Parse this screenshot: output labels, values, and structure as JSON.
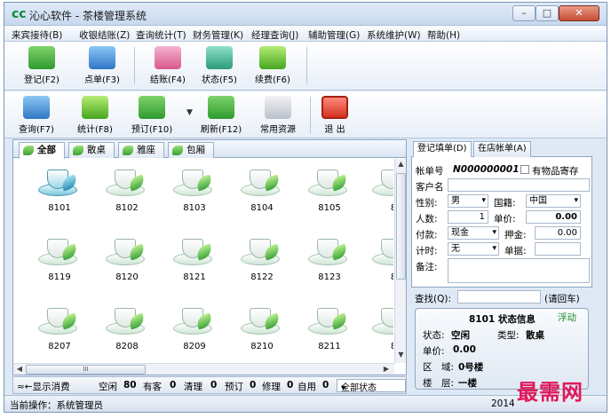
{
  "window": {
    "title": "沁心软件 - 茶楼管理系统",
    "app_icon": "cc",
    "controls": {
      "min": "–",
      "max": "□",
      "close": "✕"
    }
  },
  "menu": [
    "来宾接待(B)",
    "收银结账(Z)",
    "查询统计(T)",
    "财务管理(K)",
    "经理查询(J)",
    "辅助管理(G)",
    "系统维护(W)",
    "帮助(H)"
  ],
  "toolbar1": [
    {
      "label": "登记(F2)",
      "icon": "register-icon",
      "color": "green"
    },
    {
      "label": "点单(F3)",
      "icon": "order-icon",
      "color": "blue"
    },
    {
      "label": "结账(F4)",
      "icon": "checkout-icon",
      "color": "pink"
    },
    {
      "label": "状态(F5)",
      "icon": "status-icon",
      "color": "teal"
    },
    {
      "label": "续费(F6)",
      "icon": "renew-icon",
      "color": "lime"
    }
  ],
  "toolbar2": [
    {
      "label": "查询(F7)",
      "icon": "search-icon",
      "color": "blue"
    },
    {
      "label": "统计(F8)",
      "icon": "stats-icon",
      "color": "lime"
    },
    {
      "label": "预订(F10)",
      "icon": "reserve-icon",
      "color": "green"
    },
    {
      "label": "刷新(F12)",
      "icon": "refresh-icon",
      "color": "green"
    },
    {
      "label": "常用资源",
      "icon": "resources-icon",
      "color": "gray"
    },
    {
      "label": "退  出",
      "icon": "exit-icon",
      "color": "red"
    }
  ],
  "tabs": [
    "全部",
    "散桌",
    "雅座",
    "包厢"
  ],
  "tables": [
    "8101",
    "8102",
    "8103",
    "8104",
    "8105",
    "8",
    "8119",
    "8120",
    "8121",
    "8122",
    "8123",
    "8",
    "8207",
    "8208",
    "8209",
    "8210",
    "8211",
    "8"
  ],
  "scroll": {
    "thumb_mark": "III",
    "up": "▲",
    "down": "▼",
    "left": "◀",
    "right": "▶"
  },
  "stats": {
    "toggle": "≈←显示消费",
    "free_label": "空闲",
    "free": "80",
    "occupied_label": "有客",
    "occupied": "0",
    "cleaning_label": "清理",
    "cleaning": "0",
    "reserved_label": "预订",
    "reserved": "0",
    "repair_label": "修理",
    "repair": "0",
    "selfuse_label": "自用",
    "selfuse": "0",
    "filter": "全部状态"
  },
  "right_tabs": [
    "登记填单(D)",
    "在店帐单(A)"
  ],
  "form": {
    "bill_no_label": "帐单号",
    "bill_no": "N000000001",
    "deposit_label": "有物品寄存",
    "customer_label": "客户名",
    "customer": "",
    "gender_label": "性别:",
    "gender": "男",
    "nationality_label": "国籍:",
    "nationality": "中国",
    "people_label": "人数:",
    "people": "1",
    "price_label": "单价:",
    "price": "0.00",
    "pay_label": "付款:",
    "pay": "现金",
    "pledge_label": "押金:",
    "pledge": "0.00",
    "timing_label": "计时:",
    "timing": "无",
    "receipt_label": "单据:",
    "receipt": "",
    "note_label": "备注:",
    "note": ""
  },
  "search": {
    "label": "查找(Q):",
    "value": "",
    "hint": "(请回车)"
  },
  "info": {
    "title": "8101 状态信息",
    "float": "浮动",
    "status_label": "状态:",
    "status": "空闲",
    "type_label": "类型:",
    "type": "散桌",
    "price_label": "单价:",
    "price": "0.00",
    "area_label": "区　域:",
    "area": "0号楼",
    "floor_label": "楼　层:",
    "floor": "一楼"
  },
  "statusbar": {
    "operator": "当前操作：系统管理员",
    "date_partial": "2014"
  },
  "watermark": "最需网"
}
